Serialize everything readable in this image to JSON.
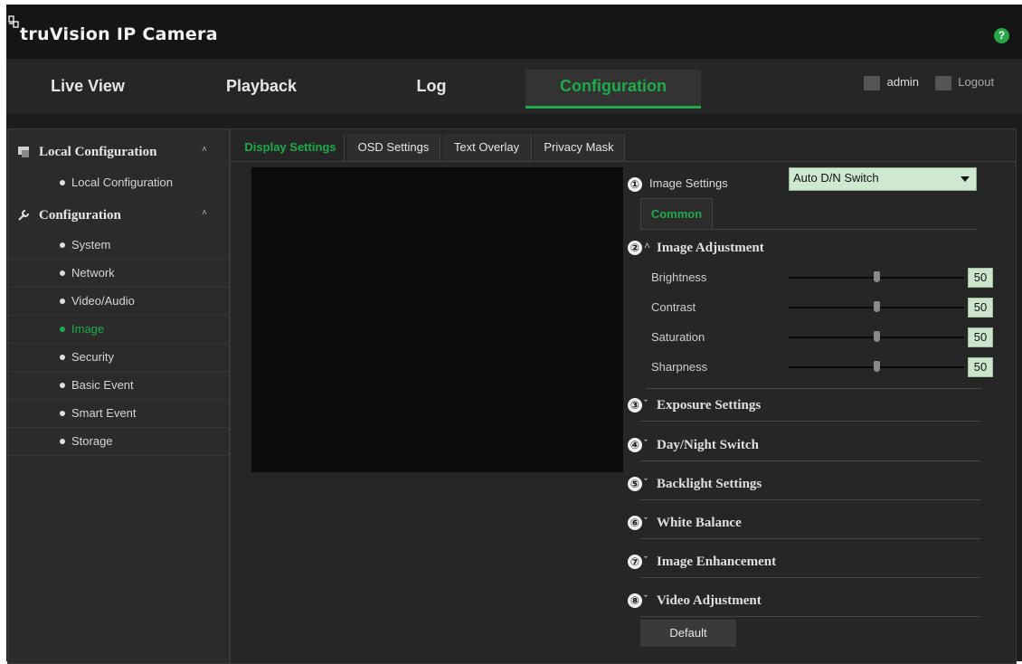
{
  "app": {
    "title": "truVision IP Camera",
    "help_icon": "help-icon"
  },
  "nav": {
    "tabs": [
      {
        "label": "Live View"
      },
      {
        "label": "Playback"
      },
      {
        "label": "Log"
      },
      {
        "label": "Configuration",
        "active": true
      }
    ],
    "user": "admin",
    "logout": "Logout"
  },
  "sidebar": {
    "groups": [
      {
        "label": "Local Configuration",
        "icon": "local-config-icon",
        "items": [
          "Local Configuration"
        ]
      },
      {
        "label": "Configuration",
        "icon": "wrench-icon",
        "items": [
          "System",
          "Network",
          "Video/Audio",
          "Image",
          "Security",
          "Basic Event",
          "Smart Event",
          "Storage"
        ]
      }
    ],
    "active_item": "Image"
  },
  "subtabs": [
    "Display Settings",
    "OSD Settings",
    "Text Overlay",
    "Privacy Mask"
  ],
  "settings": {
    "image_settings_num": "①",
    "image_settings_label": "Image Settings",
    "image_settings_value": "Auto D/N Switch",
    "common_tab": "Common",
    "adjust_num": "②",
    "adjust_title": "Image Adjustment",
    "sliders": [
      {
        "label": "Brightness",
        "value": "50"
      },
      {
        "label": "Contrast",
        "value": "50"
      },
      {
        "label": "Saturation",
        "value": "50"
      },
      {
        "label": "Sharpness",
        "value": "50"
      }
    ],
    "sections": [
      {
        "num": "③",
        "title": "Exposure Settings"
      },
      {
        "num": "④",
        "title": "Day/Night Switch"
      },
      {
        "num": "⑤",
        "title": "Backlight Settings"
      },
      {
        "num": "⑥",
        "title": "White Balance"
      },
      {
        "num": "⑦",
        "title": "Image Enhancement"
      },
      {
        "num": "⑧",
        "title": "Video Adjustment"
      }
    ],
    "default_button": "Default"
  },
  "colors": {
    "accent": "#1faa4b",
    "background": "#1d1d1d",
    "panel": "#262626"
  }
}
